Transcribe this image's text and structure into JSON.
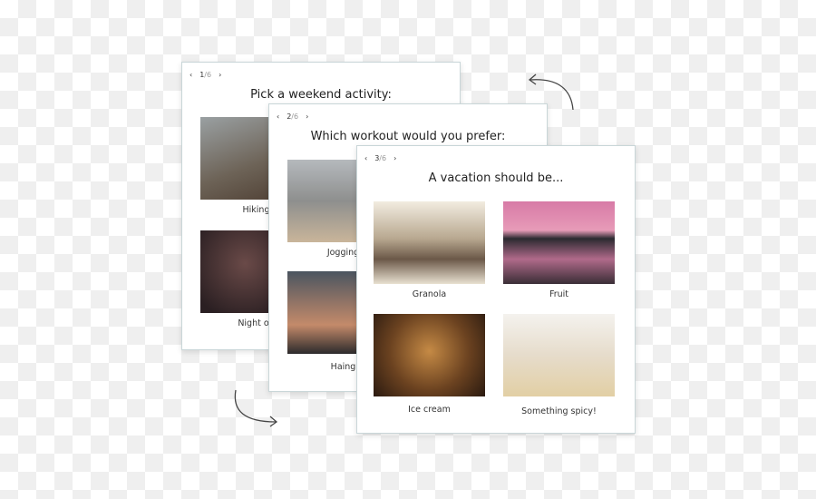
{
  "cards": [
    {
      "current": "1",
      "total": "/6",
      "question": "Pick a weekend activity:",
      "options": [
        {
          "label": "Hiking"
        },
        {
          "label": "Night ou"
        }
      ]
    },
    {
      "current": "2",
      "total": "/6",
      "question": "Which workout would you prefer:",
      "options": [
        {
          "label": "Jogging"
        },
        {
          "label": "Haing"
        }
      ]
    },
    {
      "current": "3",
      "total": "/6",
      "question": "A vacation should be...",
      "options": [
        {
          "label": "Granola"
        },
        {
          "label": "Fruit"
        },
        {
          "label": "Ice cream"
        },
        {
          "label": "Something spicy!"
        }
      ]
    }
  ],
  "icons": {
    "prev": "‹",
    "next": "›"
  }
}
